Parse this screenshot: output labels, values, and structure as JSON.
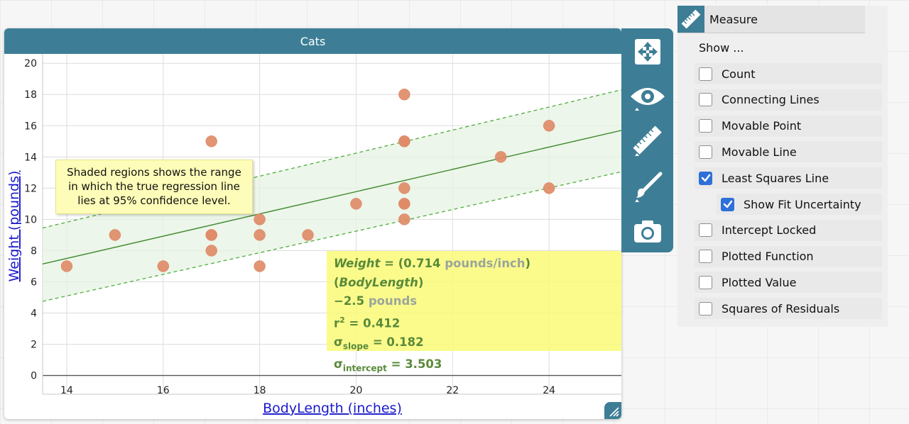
{
  "graph": {
    "title": "Cats",
    "annotation": "Shaded regions shows the range in which the true regression line lies at 95% confidence level.",
    "equation": {
      "var_y": "Weight",
      "eq_open": " = (0.714 ",
      "slope_unit": "pounds/inch",
      "close_paren": ") (",
      "var_x": "BodyLength",
      "close_paren2": ")",
      "intercept": "−2.5 ",
      "intercept_unit": "pounds",
      "r_sq_r": "r",
      "r_sq_sup": "2",
      "r_sq_value": " = 0.412",
      "sigma": "σ",
      "slope_sub": "slope",
      "slope_value": " = 0.182",
      "intercept_sub": "intercept",
      "intercept_value": " = 3.503"
    }
  },
  "chart_data": {
    "type": "scatter",
    "title": "Cats",
    "xlabel": "BodyLength (inches)",
    "ylabel": "Weight (pounds)",
    "xlim": [
      13.5,
      25.5
    ],
    "ylim": [
      -1.2,
      20.6
    ],
    "x_ticks": [
      14,
      16,
      18,
      20,
      22,
      24
    ],
    "y_ticks": [
      0,
      2,
      4,
      6,
      8,
      10,
      12,
      14,
      16,
      18,
      20
    ],
    "grid": true,
    "points": [
      {
        "x": 14,
        "y": 7
      },
      {
        "x": 15,
        "y": 9
      },
      {
        "x": 16,
        "y": 7
      },
      {
        "x": 17,
        "y": 15
      },
      {
        "x": 17,
        "y": 12
      },
      {
        "x": 17,
        "y": 9
      },
      {
        "x": 17,
        "y": 9
      },
      {
        "x": 17,
        "y": 8
      },
      {
        "x": 18,
        "y": 10
      },
      {
        "x": 18,
        "y": 9
      },
      {
        "x": 18,
        "y": 7
      },
      {
        "x": 19,
        "y": 9
      },
      {
        "x": 20,
        "y": 11
      },
      {
        "x": 21,
        "y": 18
      },
      {
        "x": 21,
        "y": 15
      },
      {
        "x": 21,
        "y": 15
      },
      {
        "x": 21,
        "y": 12
      },
      {
        "x": 21,
        "y": 11
      },
      {
        "x": 21,
        "y": 11
      },
      {
        "x": 21,
        "y": 10
      },
      {
        "x": 23,
        "y": 14
      },
      {
        "x": 24,
        "y": 16
      },
      {
        "x": 24,
        "y": 12
      }
    ],
    "regression": {
      "slope": 0.714,
      "intercept": -2.5
    },
    "confidence_band": {
      "upper": [
        {
          "x": 13.5,
          "y": 9.45
        },
        {
          "x": 25.5,
          "y": 18.3
        }
      ],
      "lower": [
        {
          "x": 13.5,
          "y": 4.75
        },
        {
          "x": 25.5,
          "y": 13.05
        }
      ],
      "center": [
        {
          "x": 13.5,
          "y": 7.14
        },
        {
          "x": 25.5,
          "y": 15.7
        }
      ]
    },
    "colors": {
      "point": "#e08c68",
      "line": "#3f8a2f",
      "band_edge": "#4fae3f",
      "band_fill": "#e7f3e3"
    }
  },
  "tools": [
    {
      "name": "graph-tool-move",
      "icon": "move-arrows-icon"
    },
    {
      "name": "graph-tool-hide-show",
      "icon": "eye-icon"
    },
    {
      "name": "graph-tool-measure",
      "icon": "ruler-icon"
    },
    {
      "name": "graph-tool-styles",
      "icon": "paintbrush-icon"
    },
    {
      "name": "graph-tool-camera",
      "icon": "camera-icon"
    }
  ],
  "measure": {
    "title": "Measure",
    "show_label": "Show ...",
    "options": [
      {
        "key": "count",
        "label": "Count",
        "checked": false,
        "indent": false
      },
      {
        "key": "connecting-lines",
        "label": "Connecting Lines",
        "checked": false,
        "indent": false
      },
      {
        "key": "movable-point",
        "label": "Movable Point",
        "checked": false,
        "indent": false
      },
      {
        "key": "movable-line",
        "label": "Movable Line",
        "checked": false,
        "indent": false
      },
      {
        "key": "least-squares-line",
        "label": "Least Squares Line",
        "checked": true,
        "indent": false
      },
      {
        "key": "show-fit-uncertainty",
        "label": "Show Fit Uncertainty",
        "checked": true,
        "indent": true
      },
      {
        "key": "intercept-locked",
        "label": "Intercept Locked",
        "checked": false,
        "indent": false
      },
      {
        "key": "plotted-function",
        "label": "Plotted Function",
        "checked": false,
        "indent": false
      },
      {
        "key": "plotted-value",
        "label": "Plotted Value",
        "checked": false,
        "indent": false
      },
      {
        "key": "squares-of-residuals",
        "label": "Squares of Residuals",
        "checked": false,
        "indent": false
      }
    ]
  }
}
